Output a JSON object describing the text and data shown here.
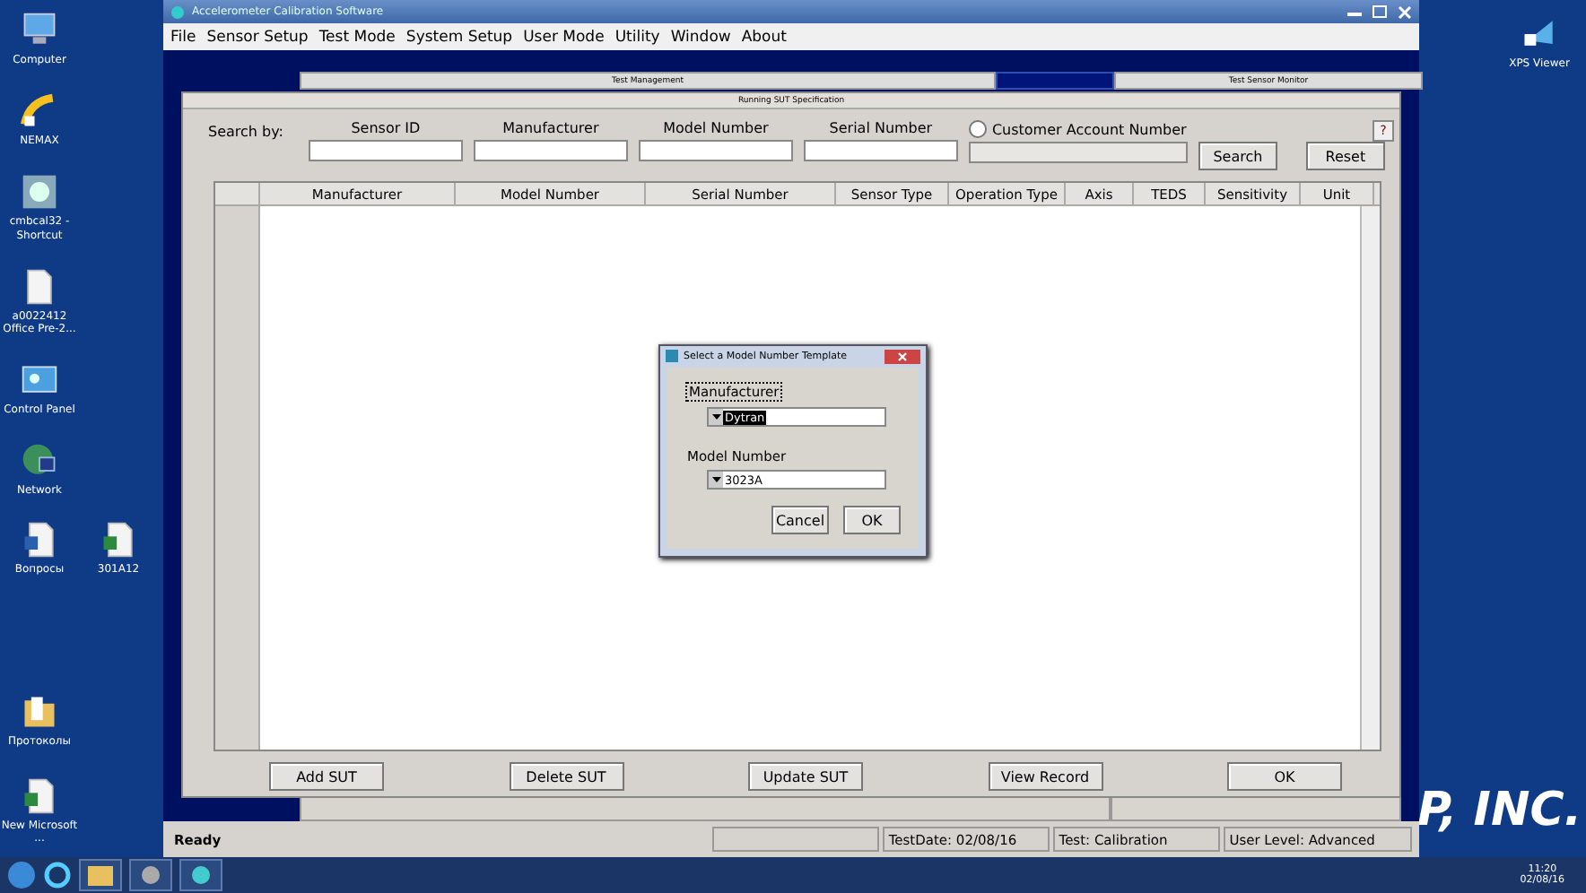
{
  "desktop_icons_left": [
    {
      "label": "Computer",
      "kind": "computer"
    },
    {
      "label": "NEMAX",
      "kind": "shortcut"
    },
    {
      "label": "cmbcal32 - Shortcut",
      "kind": "app"
    },
    {
      "label": "a0022412 Office Pre-2...",
      "kind": "file"
    },
    {
      "label": "Control Panel",
      "kind": "panel"
    },
    {
      "label": "Network",
      "kind": "network"
    }
  ],
  "desktop_icons_row": [
    {
      "label": "Вопросы",
      "kind": "word"
    },
    {
      "label": "301A12",
      "kind": "excel"
    }
  ],
  "desktop_icons_bottom": [
    {
      "label": "Протоколы",
      "kind": "folder"
    },
    {
      "label": "New Microsoft ...",
      "kind": "excel"
    }
  ],
  "desktop_icons_right": [
    {
      "label": "XPS Viewer",
      "kind": "xps"
    }
  ],
  "wallpaper_text": "P, INC.",
  "window": {
    "title": "Accelerometer Calibration Software",
    "menu": [
      "File",
      "Sensor Setup",
      "Test Mode",
      "System Setup",
      "User Mode",
      "Utility",
      "Window",
      "About"
    ],
    "tabs": [
      {
        "label": "Test Management",
        "selected": false
      },
      {
        "selected": true
      },
      {
        "label": "Test Sensor Monitor",
        "selected": false
      }
    ],
    "panel_title": "Running SUT Specification",
    "search": {
      "label": "Search by:",
      "fields": [
        {
          "label": "Sensor ID"
        },
        {
          "label": "Manufacturer"
        },
        {
          "label": "Model Number"
        },
        {
          "label": "Serial Number"
        }
      ],
      "customer_radio": {
        "label": "Customer Account Number",
        "selected": false
      },
      "buttons": [
        "Search",
        "Reset"
      ],
      "help": "?"
    },
    "table": {
      "columns": [
        "Manufacturer",
        "Model Number",
        "Serial Number",
        "Sensor Type",
        "Operation Type",
        "Axis",
        "TEDS",
        "Sensitivity",
        "Unit"
      ]
    },
    "buttons": [
      "Add SUT",
      "Delete SUT",
      "Update SUT",
      "View Record",
      "OK"
    ],
    "status_bar": [
      "Ready",
      "TestDate:  02/08/16",
      "Test: Calibration",
      "User Level: Advanced"
    ]
  },
  "dialog": {
    "title": "Select a Model Number Template",
    "fields": [
      {
        "label": "Manufacturer",
        "value": "Dytran",
        "focused": true
      },
      {
        "label": "Model Number",
        "value": "3023A",
        "focused": false
      }
    ],
    "buttons": [
      "Cancel",
      "OK"
    ]
  },
  "taskbar": {
    "time": "11:20",
    "date": "02/08/16"
  }
}
